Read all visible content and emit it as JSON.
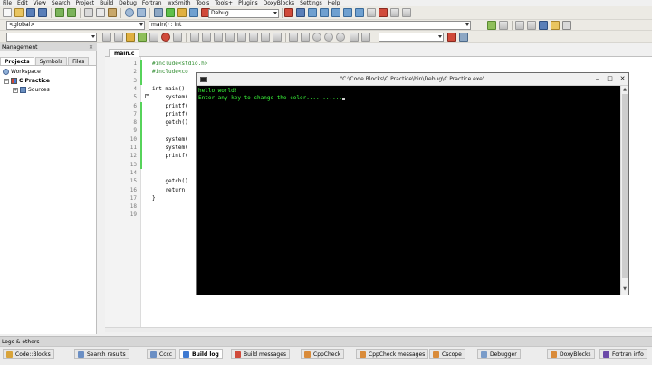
{
  "menu": [
    "File",
    "Edit",
    "View",
    "Search",
    "Project",
    "Build",
    "Debug",
    "Fortran",
    "wxSmith",
    "Tools",
    "Tools+",
    "Plugins",
    "DoxyBlocks",
    "Settings",
    "Help"
  ],
  "toolbar": {
    "build_target": "Debug",
    "scope": "<global>",
    "function": "main() : int"
  },
  "management": {
    "title": "Management",
    "tabs": [
      "Projects",
      "Symbols",
      "Files"
    ],
    "active_tab": "Projects",
    "tree": {
      "workspace": "Workspace",
      "project": "C Practice",
      "folder": "Sources"
    }
  },
  "editor": {
    "file_tab": "main.c",
    "line_numbers": [
      "1",
      "2",
      "3",
      "4",
      "5",
      "6",
      "7",
      "8",
      "9",
      "10",
      "11",
      "12",
      "13",
      "14",
      "15",
      "16",
      "17",
      "18",
      "19"
    ],
    "code_lines": [
      "#include<stdio.h>",
      "#include<co",
      "",
      "int main()",
      "    system(",
      "    printf(",
      "    printf(",
      "    getch()",
      "",
      "    system(",
      "    system(",
      "    printf(",
      "",
      "",
      "    getch()",
      "    return",
      "}",
      "",
      ""
    ]
  },
  "console": {
    "title": "\"C:\\Code Blocks\\C Practice\\bin\\Debug\\C Practice.exe\"",
    "lines": [
      "hello world!",
      "Enter any key to change the color..........."
    ],
    "minimize": "–",
    "maximize": "□",
    "close": "✕"
  },
  "logs": {
    "title": "Logs & others",
    "tabs": [
      {
        "label": "Code::Blocks",
        "color": "#d9a43a"
      },
      {
        "label": "Search results",
        "color": "#6b8fc4"
      },
      {
        "label": "Cccc",
        "color": "#6b8fc4"
      },
      {
        "label": "Build log",
        "color": "#3f7ad1"
      },
      {
        "label": "Build messages",
        "color": "#d04a3a"
      },
      {
        "label": "CppCheck",
        "color": "#d98b3a"
      },
      {
        "label": "CppCheck messages",
        "color": "#d98b3a"
      },
      {
        "label": "Cscope",
        "color": "#d98b3a"
      },
      {
        "label": "Debugger",
        "color": "#7a9cc9"
      },
      {
        "label": "DoxyBlocks",
        "color": "#d98b3a"
      },
      {
        "label": "Fortran info",
        "color": "#6b4aa8"
      }
    ],
    "active_tab": "Build log"
  },
  "colors": {
    "console_text": "#3cff3c",
    "preprocessor": "#2a8a2a",
    "change_bar": "#56d35a"
  }
}
